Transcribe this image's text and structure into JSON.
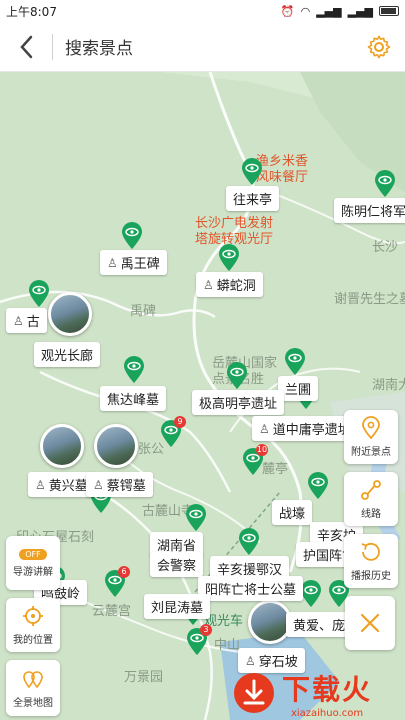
{
  "status_bar": {
    "time": "上午8:07"
  },
  "header": {
    "back_icon": "back-arrow-icon",
    "search_placeholder": "搜索景点",
    "settings_icon": "gear-icon"
  },
  "map": {
    "labels": [
      {
        "id": "canting",
        "text": "渔乡米香",
        "color": "#e0562b"
      },
      {
        "id": "canting2",
        "text": "风味餐厅",
        "color": "#e0562b"
      },
      {
        "id": "tower1",
        "text": "长沙广电发射",
        "color": "#e0562b"
      },
      {
        "id": "tower2",
        "text": "塔旋转观光厅",
        "color": "#e0562b"
      },
      {
        "id": "yubei",
        "text": "禹碑",
        "color": "#8a9a86"
      },
      {
        "id": "park1",
        "text": "岳麓山国家",
        "color": "#8a9a86"
      },
      {
        "id": "park2",
        "text": "点景名胜",
        "color": "#8a9a86"
      },
      {
        "id": "xiejin",
        "text": "谢晋先生之墓",
        "color": "#8a9a86"
      },
      {
        "id": "changsha",
        "text": "长沙",
        "color": "#8a9a86"
      },
      {
        "id": "hunan",
        "text": "湖南大",
        "color": "#8a9a86"
      },
      {
        "id": "zhanggong",
        "text": "张公",
        "color": "#8a9a86"
      },
      {
        "id": "gulu",
        "text": "古麓山寺",
        "color": "#8a9a86"
      },
      {
        "id": "lu",
        "text": "麓亭",
        "color": "#8a9a86"
      },
      {
        "id": "yinxin",
        "text": "印心石屋石刻",
        "color": "#8a9a86"
      },
      {
        "id": "yunlu",
        "text": "云麓宫",
        "color": "#8a9a86"
      },
      {
        "id": "wanjing",
        "text": "万景园",
        "color": "#8a9a86"
      },
      {
        "id": "zhongshan",
        "text": "中山",
        "color": "#8a9a86"
      },
      {
        "id": "guanguang",
        "text": "观光车",
        "color": "#3b8a5c"
      }
    ],
    "tags": {
      "wanglaiting": "往来亭",
      "chenmingren": "陈明仁将军",
      "yuwangbei": "禹王碑",
      "mangshedong": "蟒蛇洞",
      "gu": "古",
      "guanguangchanglang": "观光长廊",
      "lanyuan": "兰圃",
      "jiaodafeng": "焦达峰墓",
      "jigaoming": "极高明亭遗址",
      "daozhong": "道中庸亭遗址",
      "huangxing": "黄兴墓",
      "caie": "蔡锷墓",
      "zhanhao": "战壕",
      "xinhai1": "辛亥护",
      "xinhai1b": "护国阵亡",
      "hunansheng1": "湖南省",
      "hunansheng2": "会警察",
      "xinhai2a": "辛亥援鄂汉",
      "xinhai2b": "阳阵亡将士公墓",
      "liukunshou": "刘昆涛墓",
      "luguling": "鸣鼓岭",
      "chuanshipo": "穿石坡",
      "huangai": "黄爱、庞人"
    },
    "badges": {
      "zhanggong": "9",
      "lu": "10",
      "yunlu": "6",
      "guanguang": "3"
    }
  },
  "side_buttons": {
    "nearby": "附近景点",
    "route": "线路",
    "history": "播报历史",
    "guide": "导游讲解",
    "guide_toggle": "OFF",
    "mylocation": "我的位置",
    "panorama": "全景地图"
  },
  "watermark": {
    "title": "下载火",
    "url": "xiazaihuo.com"
  },
  "colors": {
    "accent": "#f0a020",
    "pin": "#1aa35a",
    "map_bg": "#cfe3c8"
  }
}
